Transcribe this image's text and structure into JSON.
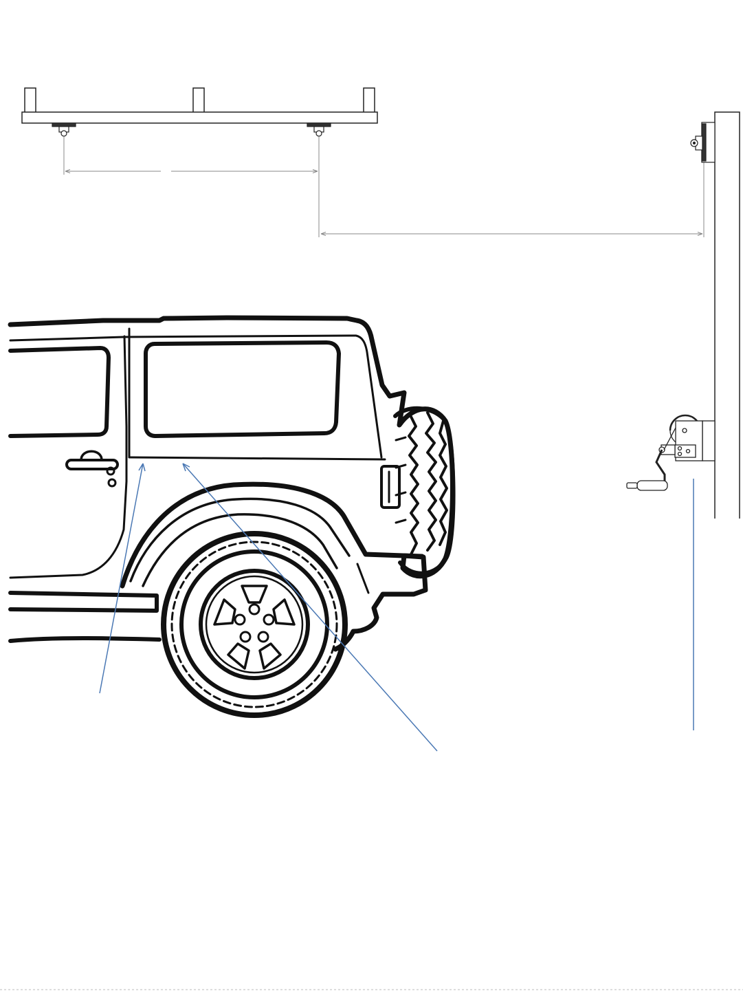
{
  "diagram": {
    "dimensions": {
      "pulley_spacing": {
        "label": ""
      },
      "pulley_to_wall": {
        "label": ""
      }
    },
    "components": {
      "roof_rack": "rack-with-uprights",
      "ceiling_pulleys": "pulley-pair",
      "wall_pulley": "pulley",
      "winch": "hand-crank-winch",
      "vehicle": "jeep-side-view"
    },
    "colors": {
      "line_art": "#111111",
      "dimension_lines": "#8a8a8a",
      "callout_lines": "#4a78b4",
      "background": "#ffffff"
    }
  }
}
